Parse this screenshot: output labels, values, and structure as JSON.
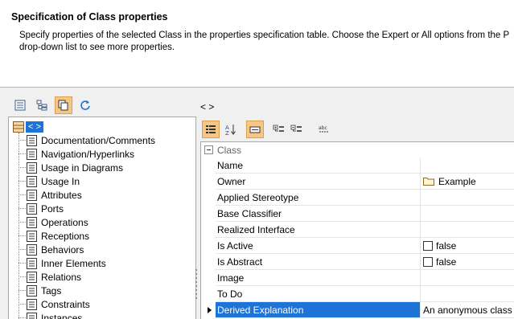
{
  "header": {
    "title": "Specification of Class properties",
    "description_line1": "Specify properties of the selected Class in the properties specification table. Choose the Expert or All options from the P",
    "description_line2": "drop-down list to see more properties."
  },
  "tree": {
    "toolbar_icons": [
      "list-view-icon",
      "tree-view-icon",
      "copy-icon",
      "refresh-icon"
    ],
    "root_label": "< >",
    "items": [
      {
        "label": "Documentation/Comments"
      },
      {
        "label": "Navigation/Hyperlinks"
      },
      {
        "label": "Usage in Diagrams"
      },
      {
        "label": "Usage In"
      },
      {
        "label": "Attributes"
      },
      {
        "label": "Ports"
      },
      {
        "label": "Operations"
      },
      {
        "label": "Receptions"
      },
      {
        "label": "Behaviors"
      },
      {
        "label": "Inner Elements"
      },
      {
        "label": "Relations"
      },
      {
        "label": "Tags"
      },
      {
        "label": "Constraints"
      },
      {
        "label": "Instances"
      }
    ]
  },
  "properties": {
    "title": "< >",
    "toolbar_icons": [
      "categorized-icon",
      "sort-alpha-icon",
      "filter-icon",
      "expand-all-icon",
      "collapse-all-icon",
      "abc-find-icon"
    ],
    "group": "Class",
    "rows": [
      {
        "name": "Name",
        "value": ""
      },
      {
        "name": "Owner",
        "value": "Example",
        "icon": "folder"
      },
      {
        "name": "Applied Stereotype",
        "value": ""
      },
      {
        "name": "Base Classifier",
        "value": ""
      },
      {
        "name": "Realized Interface",
        "value": ""
      },
      {
        "name": "Is Active",
        "value": "false",
        "icon": "checkbox"
      },
      {
        "name": "Is Abstract",
        "value": "false",
        "icon": "checkbox"
      },
      {
        "name": "Image",
        "value": ""
      },
      {
        "name": "To Do",
        "value": ""
      },
      {
        "name": "Derived Explanation",
        "value": "An anonymous class",
        "selected": true
      }
    ]
  }
}
